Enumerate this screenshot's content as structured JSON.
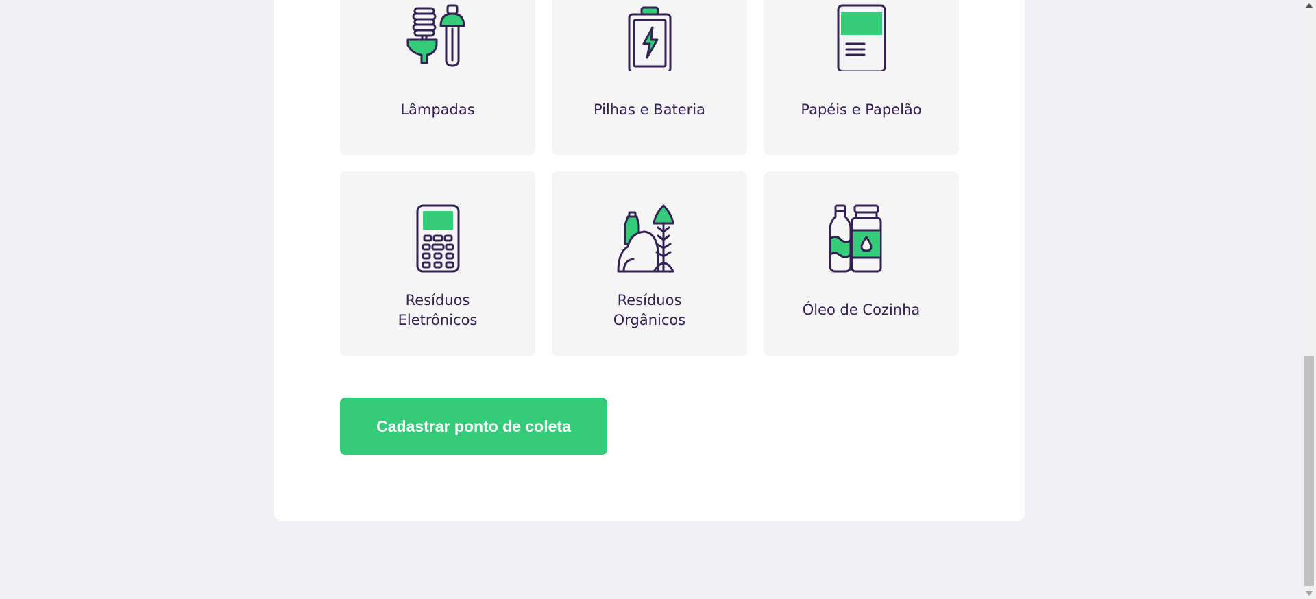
{
  "items": [
    {
      "label": "Lâmpadas",
      "icon": "lamp-icon"
    },
    {
      "label": "Pilhas e Bateria",
      "icon": "battery-icon"
    },
    {
      "label": "Papéis e Papelão",
      "icon": "paper-icon"
    },
    {
      "label_line1": "Resíduos",
      "label_line2": "Eletrônicos",
      "icon": "electronics-icon"
    },
    {
      "label_line1": "Resíduos",
      "label_line2": "Orgânicos",
      "icon": "organic-icon"
    },
    {
      "label": "Óleo de Cozinha",
      "icon": "cooking-oil-icon"
    }
  ],
  "button": {
    "label": "Cadastrar ponto de coleta"
  },
  "colors": {
    "accent": "#34CB79",
    "text": "#322153",
    "tile": "#F5F5F5",
    "background": "#F0F0F5"
  }
}
